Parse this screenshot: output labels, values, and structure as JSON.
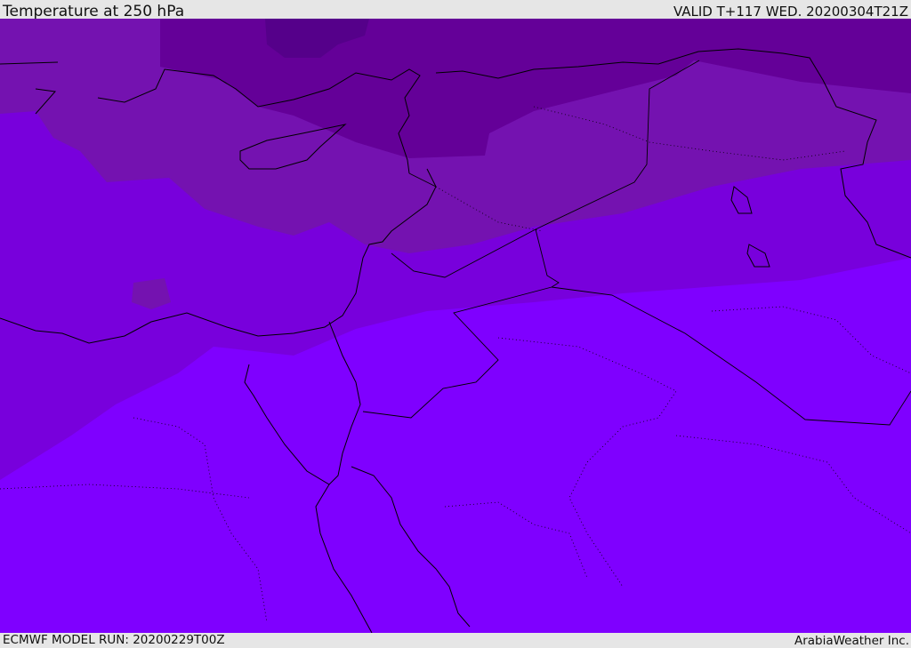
{
  "header": {
    "title": "Temperature at 250 hPa",
    "valid": "VALID T+117 WED. 20200304T21Z"
  },
  "footer": {
    "model_run": "ECMWF MODEL RUN: 20200229T00Z",
    "credit": "ArabiaWeather Inc."
  },
  "map": {
    "field": "Temperature at 250 hPa",
    "colors": {
      "band1": "#55008a",
      "band2": "#640098",
      "band3": "#7412b0",
      "band4": "#7800dc",
      "band5": "#7f00ff",
      "lines": "#000000"
    }
  }
}
